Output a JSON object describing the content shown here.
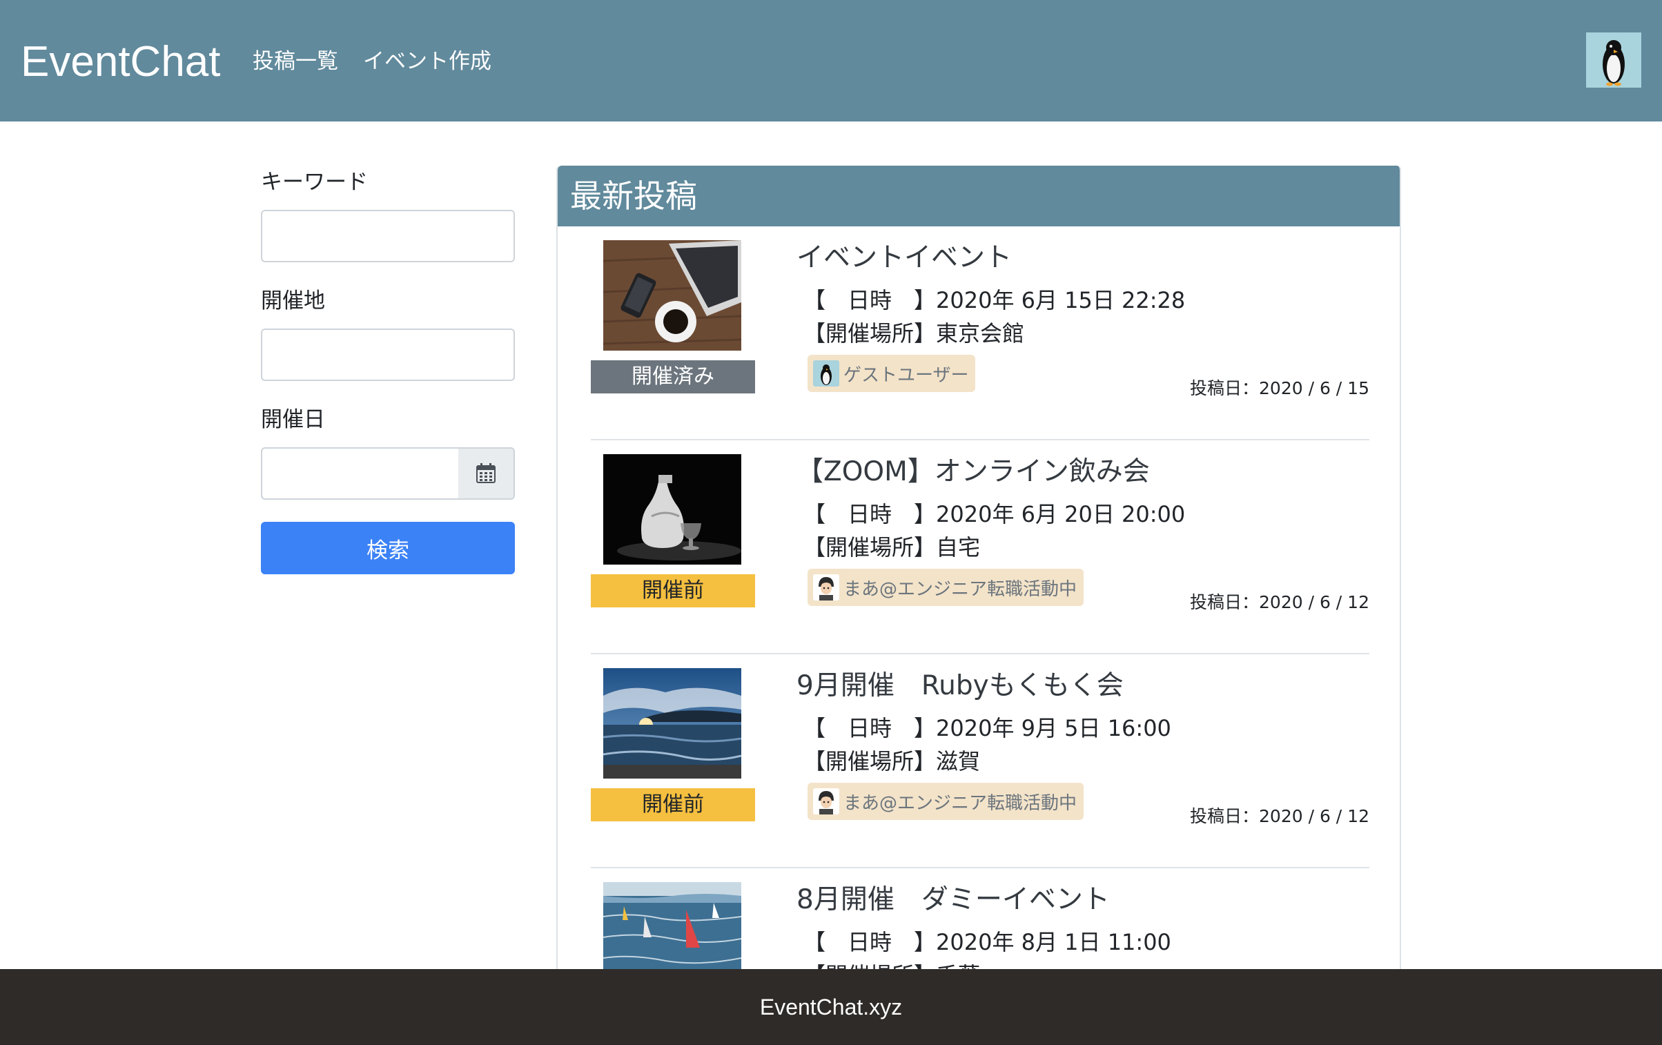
{
  "navbar": {
    "brand": "EventChat",
    "links": [
      "投稿一覧",
      "イベント作成"
    ],
    "avatar_icon": "penguin-icon"
  },
  "search": {
    "keyword_label": "キーワード",
    "keyword_value": "",
    "place_label": "開催地",
    "place_value": "",
    "date_label": "開催日",
    "date_value": "",
    "calendar_icon": "calendar-icon",
    "button_label": "検索"
  },
  "main": {
    "title": "最新投稿",
    "date_label": "【　日時　】",
    "place_label": "【開催場所】",
    "posts": [
      {
        "title": "イベントイベント",
        "datetime": "2020年 6月 15日 22:28",
        "place": "東京会館",
        "status": "開催済み",
        "user": "ゲストユーザー",
        "posted": "投稿日：2020 / 6 / 15"
      },
      {
        "title": "【ZOOM】オンライン飲み会",
        "datetime": "2020年 6月 20日 20:00",
        "place": "自宅",
        "status": "開催前",
        "user": "まあ@エンジニア転職活動中",
        "posted": "投稿日：2020 / 6 / 12"
      },
      {
        "title": "9月開催　Rubyもくもく会",
        "datetime": "2020年 9月 5日 16:00",
        "place": "滋賀",
        "status": "開催前",
        "user": "まあ@エンジニア転職活動中",
        "posted": "投稿日：2020 / 6 / 12"
      },
      {
        "title": "8月開催　ダミーイベント",
        "datetime": "2020年 8月 1日 11:00",
        "place": "千葉",
        "status": "",
        "user": "",
        "posted": ""
      }
    ]
  },
  "footer": {
    "text": "EventChat.xyz"
  },
  "colors": {
    "header": "#618a9c",
    "button": "#3b82f6",
    "done": "#6c757d",
    "before": "#f5bf3f",
    "footer": "#2f2b28"
  }
}
